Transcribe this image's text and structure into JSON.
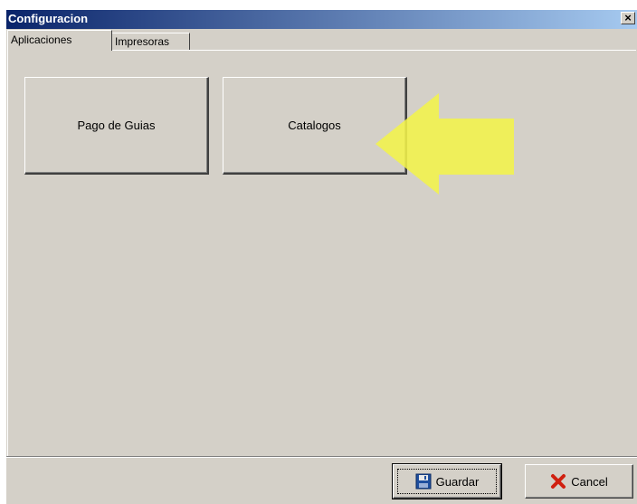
{
  "window": {
    "title": "Configuracion",
    "close_label": "×"
  },
  "tabs": [
    {
      "label": "Aplicaciones",
      "active": true
    },
    {
      "label": "Impresoras",
      "active": false
    }
  ],
  "applications": {
    "buttons": [
      {
        "label": "Pago de Guias"
      },
      {
        "label": "Catalogos"
      }
    ]
  },
  "annotation": {
    "arrow_color": "#f2f24a",
    "icon": "highlight-arrow-icon"
  },
  "footer": {
    "save_label": "Guardar",
    "save_icon": "floppy-disk-icon",
    "cancel_label": "Cancel",
    "cancel_icon": "red-x-icon"
  },
  "colors": {
    "title_gradient_start": "#0a246a",
    "title_gradient_end": "#a6caf0",
    "face": "#d4d0c8"
  }
}
